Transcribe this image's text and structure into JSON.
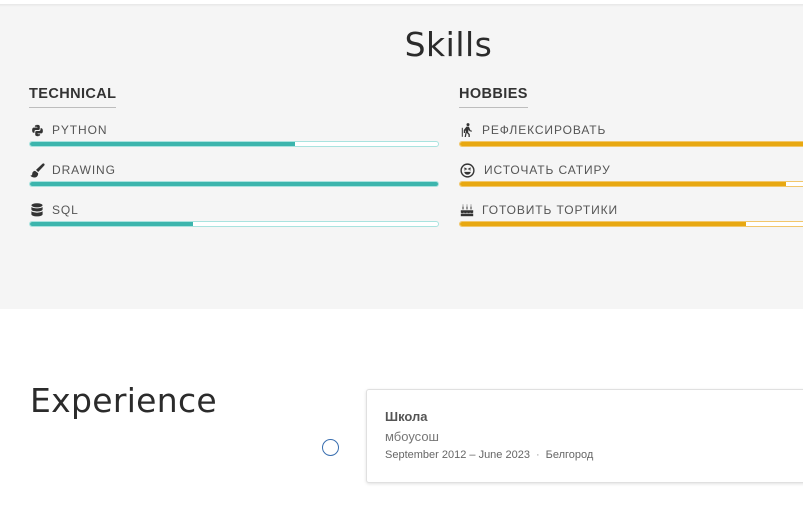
{
  "skills": {
    "title": "Skills",
    "technical": {
      "heading": "TECHNICAL",
      "items": [
        {
          "label": "PYTHON",
          "icon": "python-icon",
          "level": 0.65
        },
        {
          "label": "DRAWING",
          "icon": "paintbrush-icon",
          "level": 1.0
        },
        {
          "label": "SQL",
          "icon": "database-icon",
          "level": 0.4
        }
      ]
    },
    "hobbies": {
      "heading": "HOBBIES",
      "items": [
        {
          "label": "РЕФЛЕКСИРОВАТЬ",
          "icon": "person-walking-icon",
          "level": 1.0
        },
        {
          "label": "ИСТОЧАТЬ САТИРУ",
          "icon": "grin-squint-icon",
          "level": 0.91
        },
        {
          "label": "ГОТОВИТЬ ТОРТИКИ",
          "icon": "birthday-cake-icon",
          "level": 0.8
        }
      ]
    },
    "colors": {
      "technical": "#3cb5ad",
      "hobbies": "#e8a811",
      "background": "#f5f5f5"
    }
  },
  "experience": {
    "title": "Experience",
    "entries": [
      {
        "organization": "Школа",
        "role": "мбоусош",
        "dates": "September 2012 – June 2023",
        "separator": "·",
        "location": "Белгород"
      }
    ]
  }
}
